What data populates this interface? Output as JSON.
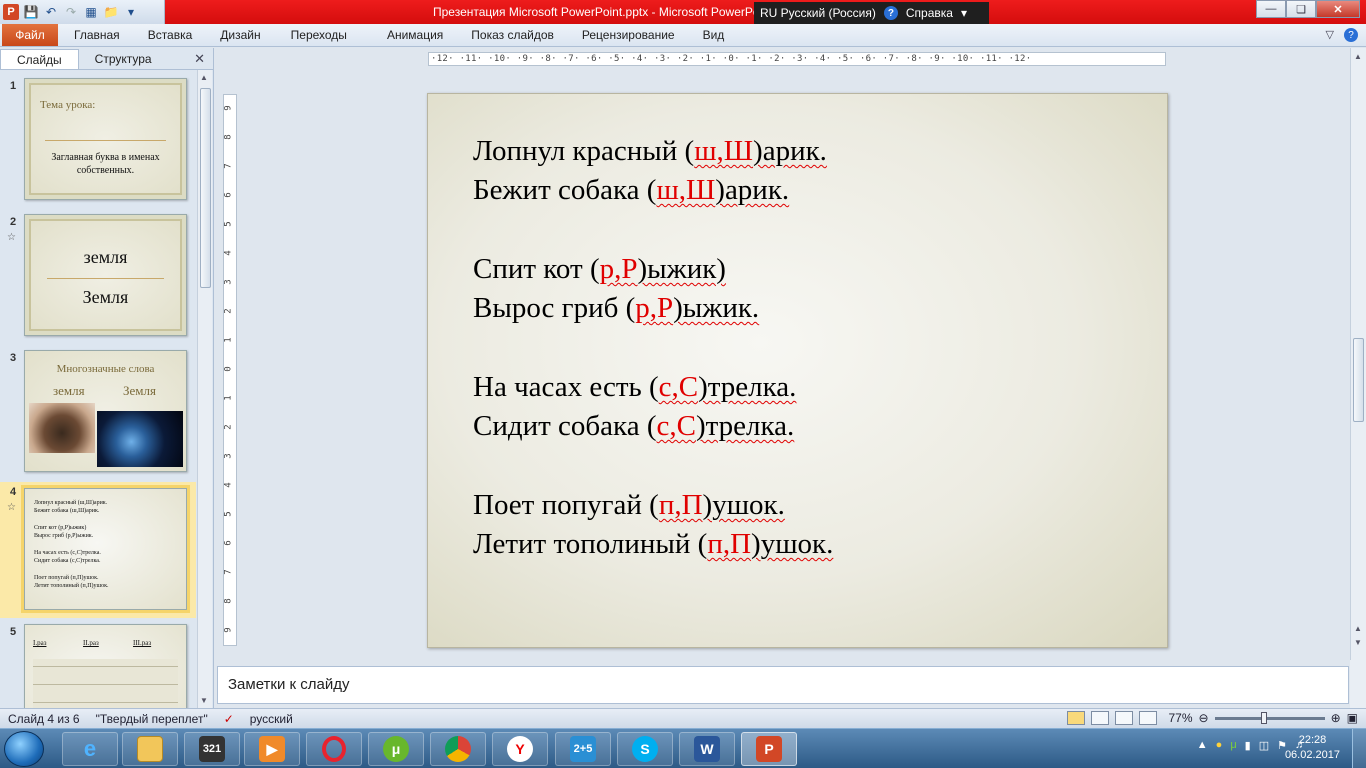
{
  "window": {
    "title": "Презентация Microsoft PowerPoint.pptx  -  Microsoft PowerPoint",
    "lang_indicator": "RU Русский (Россия)",
    "help_label": "Справка"
  },
  "ribbon": {
    "file_tab": "Файл",
    "tabs": [
      "Главная",
      "Вставка",
      "Дизайн",
      "Переходы",
      "Анимация",
      "Показ слайдов",
      "Рецензирование",
      "Вид"
    ]
  },
  "left_panel": {
    "tabs": [
      "Слайды",
      "Структура"
    ],
    "thumbnails": [
      {
        "num": "1",
        "title": "Тема урока:",
        "body": "Заглавная буква в именах собственных."
      },
      {
        "num": "2",
        "top": "земля",
        "bottom": "Земля"
      },
      {
        "num": "3",
        "title": "Многозначные слова",
        "left": "земля",
        "right": "Земля"
      },
      {
        "num": "4",
        "lines": [
          "Лопнул красный (ш,Ш)арик.",
          "Бежит собака (ш,Ш)арик.",
          "Спит кот (р,Р)ыжик)",
          "Вырос гриб (р,Р)ыжик.",
          "На часах  есть (с,С)трелка.",
          "Сидит собака (с,С)трелка.",
          "Поет попугай (п,П)ушок.",
          "Летит тополиный (п,П)ушок."
        ]
      },
      {
        "num": "5",
        "headers": [
          "I.раз",
          "II.раз",
          "III.раз"
        ]
      }
    ]
  },
  "rulers": {
    "horizontal": "·12· ·11· ·10· ·9· ·8· ·7· ·6· ·5· ·4· ·3· ·2· ·1· ·0· ·1· ·2· ·3· ·4· ·5· ·6· ·7· ·8· ·9· ·10· ·11· ·12·",
    "vertical": [
      "9",
      "8",
      "7",
      "6",
      "5",
      "4",
      "3",
      "2",
      "1",
      "0",
      "1",
      "2",
      "3",
      "4",
      "5",
      "6",
      "7",
      "8",
      "9"
    ]
  },
  "slide": {
    "groups": [
      [
        {
          "before": "Лопнул красный (",
          "red": "ш,Ш",
          "after": ")арик."
        },
        {
          "before": "Бежит собака (",
          "red": "ш,Ш",
          "after": ")арик."
        }
      ],
      [
        {
          "before": "Спит кот (",
          "red": "р,Р",
          "after": ")ыжик)"
        },
        {
          "before": "Вырос гриб (",
          "red": "р,Р",
          "after": ")ыжик."
        }
      ],
      [
        {
          "before": "На часах  есть (",
          "red": "с,С",
          "after": ")трелка."
        },
        {
          "before": "Сидит собака (",
          "red": "с,С",
          "after": ")трелка."
        }
      ],
      [
        {
          "before": "Поет попугай (",
          "red": "п,П",
          "after": ")ушок."
        },
        {
          "before": "Летит тополиный (",
          "red": "п,П",
          "after": ")ушок."
        }
      ]
    ]
  },
  "notes": {
    "placeholder": "Заметки к слайду"
  },
  "status": {
    "slide_counter": "Слайд 4 из 6",
    "theme": "\"Твердый переплет\"",
    "language": "русский",
    "zoom": "77%"
  },
  "taskbar": {
    "clock_time": "22:28",
    "clock_date": "06.02.2017",
    "apps": [
      "ie",
      "explorer",
      "media-player-classic",
      "media-player",
      "opera",
      "utorrent",
      "chrome",
      "yandex",
      "calculator",
      "skype",
      "word",
      "powerpoint"
    ]
  },
  "colors": {
    "accent_red": "#e00000",
    "file_tab": "#d0521f",
    "title_bar": "#e01515"
  }
}
